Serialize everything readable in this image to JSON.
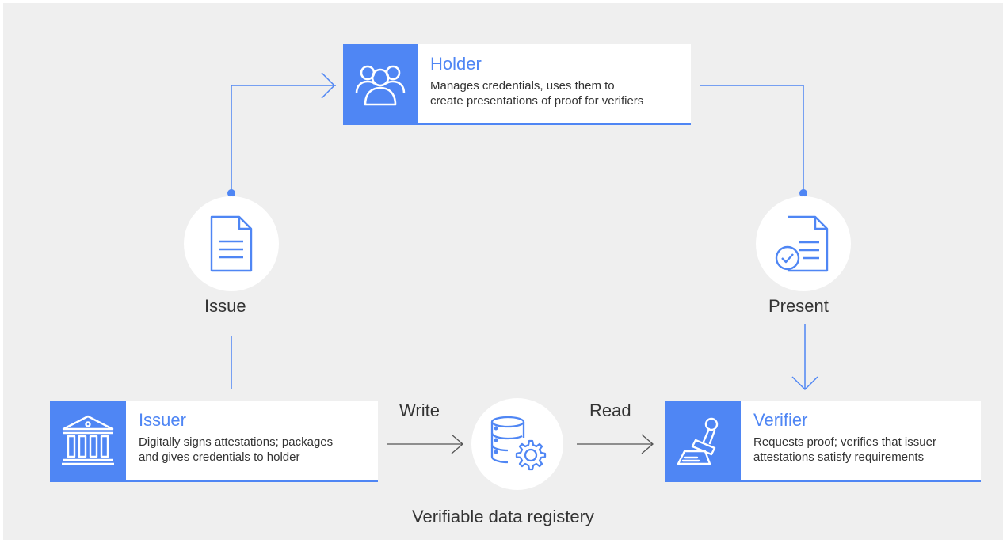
{
  "holder": {
    "icon": "group-icon",
    "title": "Holder",
    "description_line1": "Manages credentials, uses them to",
    "description_line2": "create presentations of proof for verifiers"
  },
  "issuer": {
    "icon": "bank-icon",
    "title": "Issuer",
    "description_line1": "Digitally signs attestations; packages",
    "description_line2": "and gives credentials to holder"
  },
  "verifier": {
    "icon": "stamp-icon",
    "title": "Verifier",
    "description_line1": "Requests proof; verifies that issuer",
    "description_line2": "attestations satisfy requirements"
  },
  "steps": {
    "issue": "Issue",
    "present": "Present",
    "write": "Write",
    "read": "Read"
  },
  "registry": {
    "icon": "database-gear-icon",
    "label": "Verifiable data registery"
  },
  "colors": {
    "accent": "#4f86f4",
    "background": "#efefef",
    "text": "#333333"
  }
}
